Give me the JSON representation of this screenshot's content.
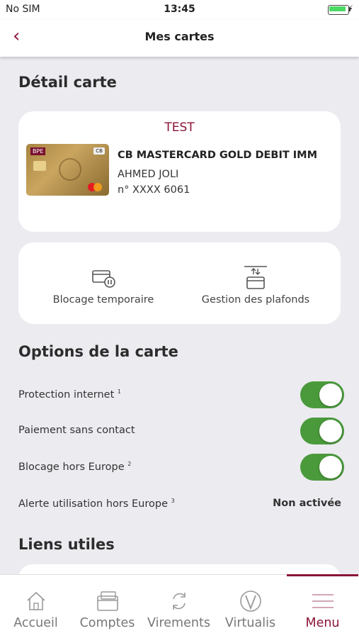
{
  "status_bar": {
    "carrier": "No SIM",
    "time": "13:45"
  },
  "nav": {
    "title": "Mes cartes",
    "back_icon": "chevron-left-icon"
  },
  "detail": {
    "title": "Détail carte",
    "card": {
      "nickname": "TEST",
      "name": "CB MASTERCARD GOLD DEBIT IMM",
      "holder": "AHMED JOLI",
      "number": "n° XXXX 6061",
      "image_labels": {
        "bank": "BPE",
        "network": "CB"
      }
    },
    "actions": [
      {
        "label": "Blocage temporaire",
        "icon": "card-pause-icon"
      },
      {
        "label": "Gestion des plafonds",
        "icon": "card-limits-icon"
      }
    ]
  },
  "options": {
    "title": "Options de la carte",
    "rows": [
      {
        "label": "Protection internet",
        "note": "1",
        "enabled": true
      },
      {
        "label": "Paiement sans contact",
        "note": "",
        "enabled": true
      },
      {
        "label": "Blocage hors Europe",
        "note": "2",
        "enabled": true
      },
      {
        "label": "Alerte utilisation hors Europe",
        "note": "3",
        "status": "Non activée"
      }
    ]
  },
  "links": {
    "title": "Liens utiles"
  },
  "tabs": [
    {
      "label": "Accueil",
      "icon": "home-icon",
      "active": false
    },
    {
      "label": "Comptes",
      "icon": "accounts-icon",
      "active": false
    },
    {
      "label": "Virements",
      "icon": "transfer-icon",
      "active": false
    },
    {
      "label": "Virtualis",
      "icon": "virtualis-icon",
      "active": false
    },
    {
      "label": "Menu",
      "icon": "menu-icon",
      "active": true
    }
  ],
  "colors": {
    "brand": "#8a1538",
    "toggle_on": "#4a9a3c",
    "background": "#ecebf0",
    "battery": "#4cd964"
  }
}
